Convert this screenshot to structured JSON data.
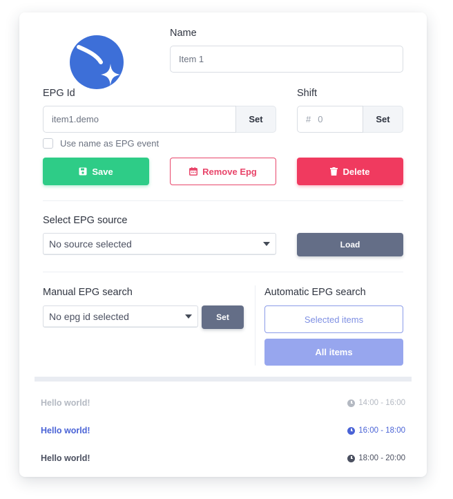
{
  "name_section": {
    "label": "Name",
    "value": "Item 1"
  },
  "epg_id": {
    "label": "EPG Id",
    "value": "item1.demo",
    "set_label": "Set"
  },
  "shift": {
    "label": "Shift",
    "prefix": "#",
    "placeholder": "0",
    "set_label": "Set"
  },
  "use_name_checkbox": {
    "label": "Use name as EPG event",
    "checked": false
  },
  "actions": {
    "save": "Save",
    "remove_epg": "Remove Epg",
    "delete": "Delete"
  },
  "source": {
    "label": "Select EPG source",
    "selected": "No source selected",
    "load": "Load"
  },
  "manual_search": {
    "label": "Manual EPG search",
    "selected": "No epg id selected",
    "set": "Set"
  },
  "automatic_search": {
    "label": "Automatic EPG search",
    "selected_items": "Selected items",
    "all_items": "All items"
  },
  "events": [
    {
      "title": "Hello world!",
      "time": "14:00 - 16:00",
      "state": "past"
    },
    {
      "title": "Hello world!",
      "time": "16:00 - 18:00",
      "state": "current"
    },
    {
      "title": "Hello world!",
      "time": "18:00 - 20:00",
      "state": "upcoming"
    }
  ],
  "colors": {
    "logo": "#3d6fd8",
    "save": "#2ecc87",
    "danger": "#f03a5f",
    "slate": "#646e87",
    "accent_blue": "#4a63d6",
    "soft_blue": "#97a6ee"
  }
}
